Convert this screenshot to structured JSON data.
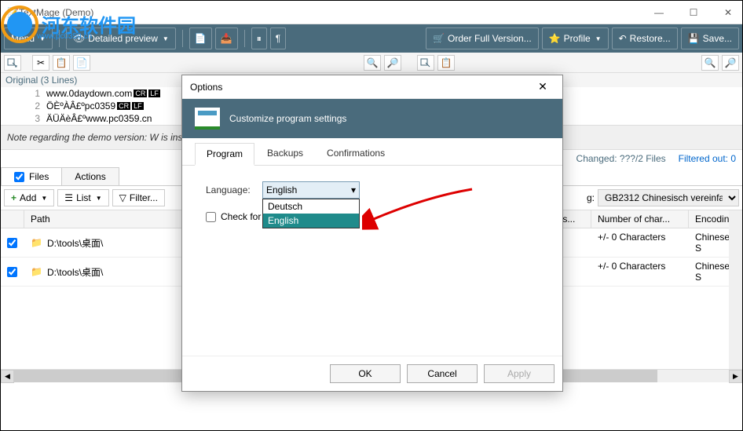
{
  "watermark": {
    "text": "河东软件园",
    "url": "www.pc0359.cn"
  },
  "window": {
    "title": "TextMage (Demo)"
  },
  "toolbar": {
    "menu": "Menu",
    "preview": "Detailed preview",
    "order": "Order Full Version...",
    "profile": "Profile",
    "restore": "Restore...",
    "save": "Save..."
  },
  "original": {
    "label": "Original (3 Lines)",
    "lines": [
      {
        "num": "1",
        "text": "www.0daydown.com",
        "crlf": true
      },
      {
        "num": "2",
        "text": "ÖÈºÀÂ£ºpc0359",
        "crlf": true
      },
      {
        "num": "3",
        "text": "ÄÜÄèÂ£ºwww.pc0359.cn",
        "crlf": false
      }
    ]
  },
  "demo_note": "Note regarding the demo version: W                                                                                                                                          is inserted at the beginning and e...",
  "status": {
    "changed": "Changed: ???/2 Files",
    "filtered": "Filtered out: 0"
  },
  "tabs": {
    "files": "Files",
    "actions": "Actions"
  },
  "actions": {
    "add": "Add",
    "list": "List",
    "filter": "Filter...",
    "encoding_label": "g:",
    "encoding_value": "GB2312 Chinesisch vereinfacht"
  },
  "grid": {
    "headers": {
      "path": "Path",
      "lines": "f lines...",
      "chars": "Number of char...",
      "encoding": "Encoding"
    },
    "rows": [
      {
        "path": "D:\\tools\\桌面\\",
        "chars": "+/- 0 Characters",
        "encoding": "Chinese S"
      },
      {
        "path": "D:\\tools\\桌面\\",
        "chars": "+/- 0 Characters",
        "encoding": "Chinese S"
      }
    ]
  },
  "dialog": {
    "title": "Options",
    "header": "Customize program settings",
    "tabs": {
      "program": "Program",
      "backups": "Backups",
      "confirmations": "Confirmations"
    },
    "language_label": "Language:",
    "language_value": "English",
    "language_options": [
      "Deutsch",
      "English"
    ],
    "check_label": "Check for",
    "buttons": {
      "ok": "OK",
      "cancel": "Cancel",
      "apply": "Apply"
    }
  }
}
